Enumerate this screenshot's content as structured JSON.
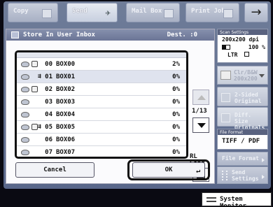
{
  "top_tabs": [
    {
      "label": "Copy",
      "icon": "copy-icon",
      "active": false
    },
    {
      "label": "Send",
      "icon": "send-icon",
      "active": true
    },
    {
      "label": "Mail Box",
      "icon": "mailbox-icon",
      "active": false
    },
    {
      "label": "Print Job",
      "icon": "print-icon",
      "active": false
    }
  ],
  "top_arrow": "→",
  "dialog": {
    "title": "Store In User Inbox",
    "dest": "Dest. :0",
    "boxes": [
      {
        "num": "00",
        "name": "BOX00",
        "pct": "2%",
        "lock": true,
        "fwd": false,
        "selected": false
      },
      {
        "num": "01",
        "name": "BOX01",
        "pct": "0%",
        "lock": false,
        "fwd": true,
        "selected": true
      },
      {
        "num": "02",
        "name": "BOX02",
        "pct": "0%",
        "lock": true,
        "fwd": false,
        "selected": false
      },
      {
        "num": "03",
        "name": "BOX03",
        "pct": "0%",
        "lock": false,
        "fwd": false,
        "selected": false
      },
      {
        "num": "04",
        "name": "BOX04",
        "pct": "0%",
        "lock": false,
        "fwd": false,
        "selected": false
      },
      {
        "num": "05",
        "name": "BOX05",
        "pct": "0%",
        "lock": true,
        "fwd": true,
        "selected": false
      },
      {
        "num": "06",
        "name": "BOX06",
        "pct": "0%",
        "lock": false,
        "fwd": false,
        "selected": false
      },
      {
        "num": "07",
        "name": "BOX07",
        "pct": "0%",
        "lock": false,
        "fwd": false,
        "selected": false
      }
    ],
    "page": "1/13",
    "rl_send": "RL Send",
    "cancel_label": "Cancel",
    "ok_label": "OK",
    "ok_return_glyph": "↵"
  },
  "scan_settings": {
    "header": "Scan Settings",
    "resolution": "200x200 dpi",
    "density": "100 %",
    "size": "LTR"
  },
  "color_button": {
    "line1": "Clr/B&W",
    "line2": "200x200"
  },
  "two_sided": {
    "line1": "2-Sided",
    "line2": "Original"
  },
  "diff_size": {
    "line1": "Diff. Size",
    "line2": "Originals"
  },
  "file_format": {
    "header": "File Format",
    "value": "TIFF / PDF",
    "button": "File Format"
  },
  "send_settings": {
    "line1": "Send",
    "line2": "Settings"
  },
  "system_monitor": "System Monitor",
  "colors": {
    "title_bar": "#6b7596",
    "screen_bg": "#6f7d99",
    "selected_row": "#dfe3ee"
  }
}
